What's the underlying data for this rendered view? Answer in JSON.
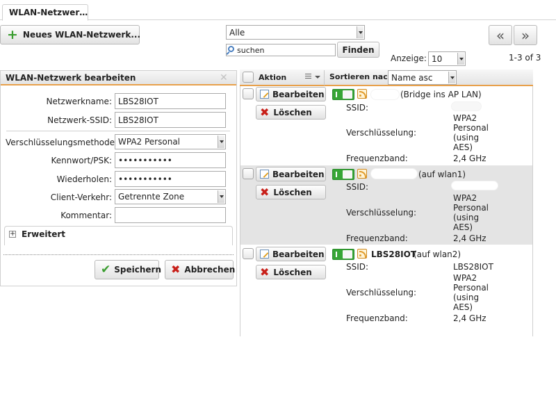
{
  "tab": {
    "label": "WLAN-Netzwer…"
  },
  "toolbar": {
    "new_network": "Neues WLAN-Netzwerk...",
    "filter_value": "Alle",
    "search_placeholder": "suchen",
    "find_button": "Finden",
    "prev_label": "«",
    "next_label": "»",
    "count_label": "Anzeige:",
    "count_value": "10",
    "range": "1-3 of 3"
  },
  "form": {
    "title": "WLAN-Netzwerk bearbeiten",
    "close_label": "✕",
    "name_label": "Netzwerkname:",
    "name_value": "LBS28IOT",
    "ssid_label": "Netzwerk-SSID:",
    "ssid_value": "LBS28IOT",
    "enc_label": "Verschlüsselungsmethode:",
    "enc_value": "WPA2 Personal",
    "psk_label": "Kennwort/PSK:",
    "psk_value": "•••••••••••",
    "repeat_label": "Wiederholen:",
    "repeat_value": "•••••••••••",
    "client_label": "Client-Verkehr:",
    "client_value": "Getrennte Zone",
    "comment_label": "Kommentar:",
    "comment_value": "",
    "advanced_label": "Erweitert",
    "advanced_toggle": "+",
    "save_label": "Speichern",
    "cancel_label": "Abbrechen"
  },
  "list": {
    "col_action": "Aktion",
    "col_sort_label": "Sortieren nach:",
    "sort_value": "Name asc",
    "edit_label": "Bearbeiten",
    "delete_label": "Löschen",
    "ssid_label": "SSID:",
    "enc_label": "Verschlüsselung:",
    "freq_label": "Frequenzband:",
    "items": [
      {
        "name": "",
        "suffix": "(Bridge ins AP LAN)",
        "ssid": "",
        "enc1": "WPA2",
        "enc2": "Personal",
        "enc3": "(using",
        "enc4": "AES)",
        "freq": "2,4 GHz"
      },
      {
        "name": "",
        "suffix": "(auf wlan1)",
        "ssid": "",
        "enc1": "WPA2",
        "enc2": "Personal",
        "enc3": "(using",
        "enc4": "AES)",
        "freq": "2,4 GHz"
      },
      {
        "name": "LBS28IOT",
        "suffix": "(auf wlan2)",
        "ssid": "LBS28IOT",
        "enc1": "WPA2",
        "enc2": "Personal",
        "enc3": "(using",
        "enc4": "AES)",
        "freq": "2,4 GHz"
      }
    ]
  },
  "colors": {
    "accent": "#e8a04a",
    "toggle_on": "#36a535",
    "delete": "#c8201a",
    "add": "#3a9d2f"
  }
}
